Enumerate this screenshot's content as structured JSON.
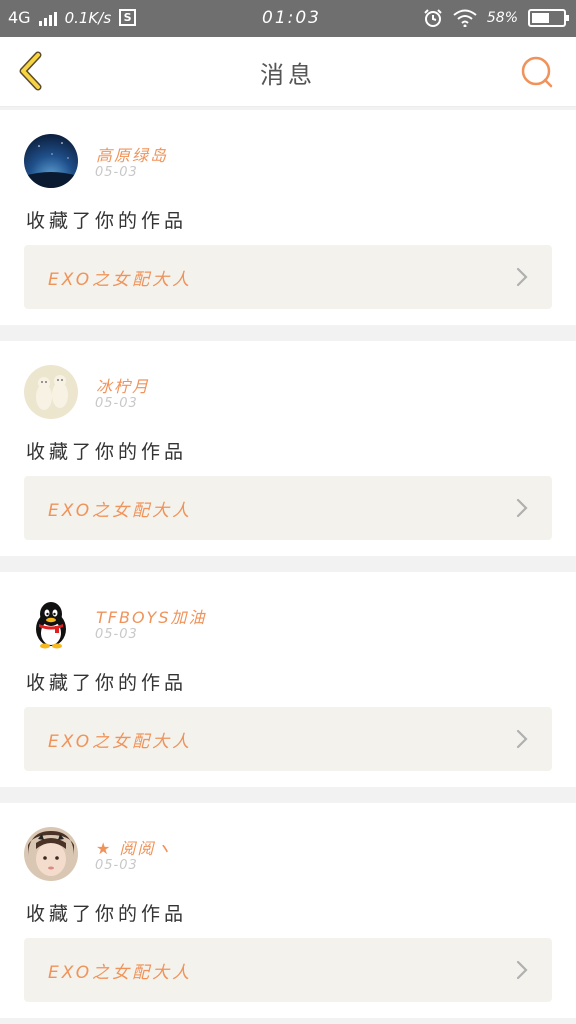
{
  "status_bar": {
    "network": "4G",
    "speed": "0.1K/s",
    "speed_badge": "S",
    "time": "01:03",
    "battery_text": "58%",
    "battery_level": 0.58
  },
  "nav": {
    "title": "消息",
    "back_icon": "chevron-left-icon",
    "search_icon": "search-icon",
    "accent_color": "#f0935a",
    "back_color": "#f6d443"
  },
  "notifications": [
    {
      "username": "高原绿岛",
      "date": "05-03",
      "action": "收藏了你的作品",
      "work_title": "EXO之女配大人",
      "avatar": "night-sky-avatar"
    },
    {
      "username": "冰柠月",
      "date": "05-03",
      "action": "收藏了你的作品",
      "work_title": "EXO之女配大人",
      "avatar": "polar-bear-avatar"
    },
    {
      "username": "TFBOYS加油",
      "date": "05-03",
      "action": "收藏了你的作品",
      "work_title": "EXO之女配大人",
      "avatar": "penguin-avatar"
    },
    {
      "username": "★ 阅阅ヽ",
      "date": "05-03",
      "action": "收藏了你的作品",
      "work_title": "EXO之女配大人",
      "avatar": "child-photo-avatar"
    }
  ]
}
